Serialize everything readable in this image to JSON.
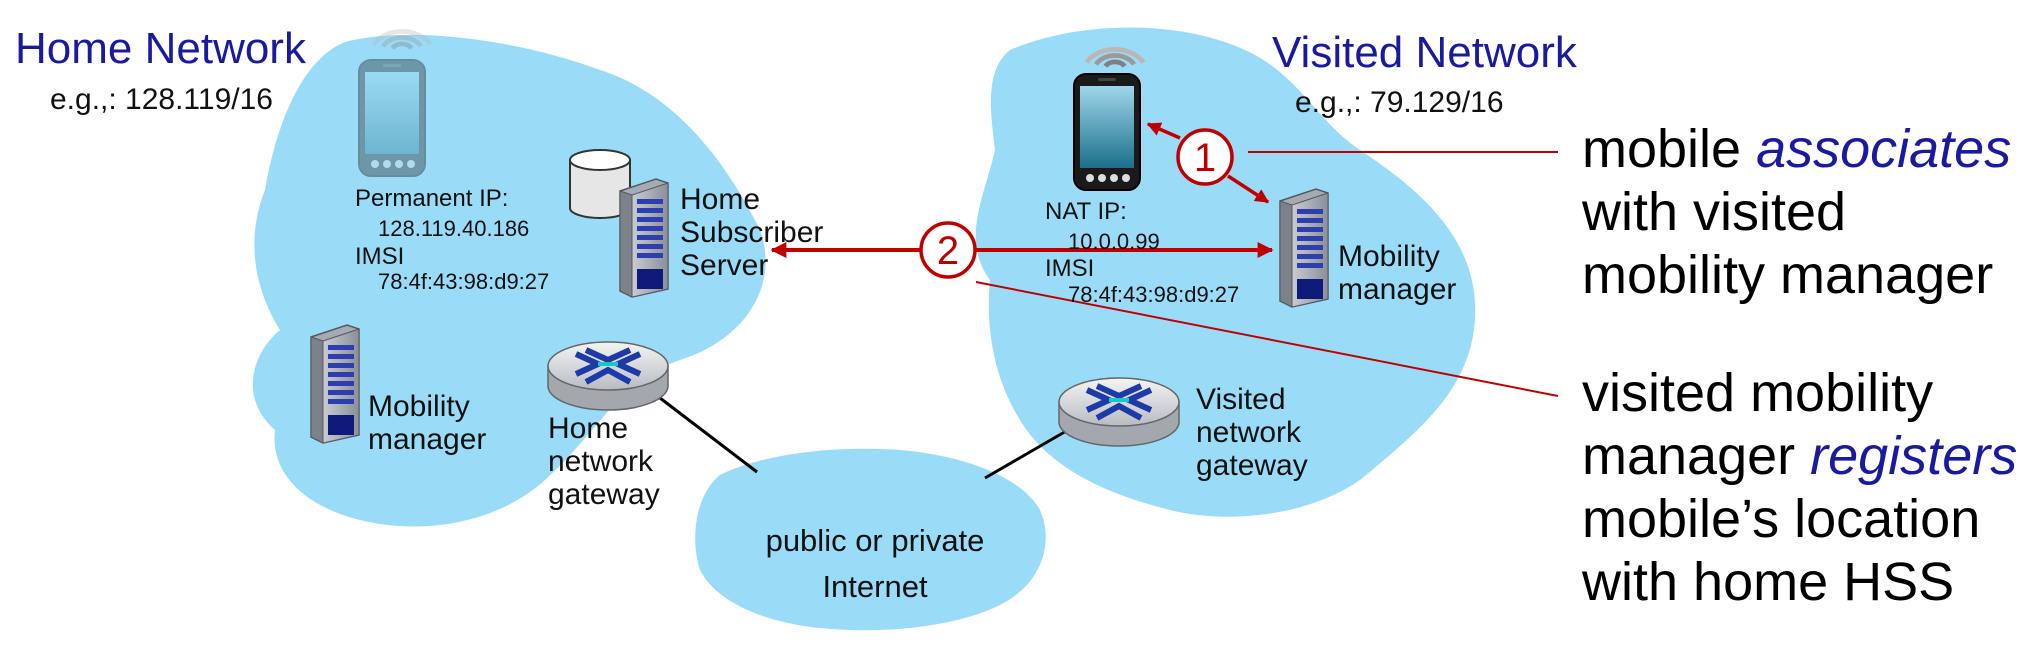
{
  "home": {
    "title": "Home Network",
    "subnet": "e.g.,: 128.119/16",
    "permanent_ip_label": "Permanent IP:",
    "permanent_ip": "128.119.40.186",
    "imsi_label": "IMSI",
    "imsi": "78:4f:43:98:d9:27",
    "hss_label": [
      "Home",
      "Subscriber",
      "Server"
    ],
    "mobility_manager_label": [
      "Mobility",
      "manager"
    ],
    "gateway_label": [
      "Home",
      "network",
      "gateway"
    ]
  },
  "visited": {
    "title": "Visited Network",
    "subnet": "e.g.,: 79.129/16",
    "nat_ip_label": "NAT IP:",
    "nat_ip": "10.0.0.99",
    "imsi_label": "IMSI",
    "imsi": "78:4f:43:98:d9:27",
    "mobility_manager_label": [
      "Mobility",
      "manager"
    ],
    "gateway_label": [
      "Visited",
      "network",
      "gateway"
    ]
  },
  "internet": {
    "label": [
      "public or  private",
      "Internet"
    ]
  },
  "steps": [
    {
      "number": "1",
      "text_before": "mobile ",
      "emphasis": "associates",
      "text_after": [
        "with visited",
        "mobility manager"
      ]
    },
    {
      "number": "2",
      "line1": "visited mobility",
      "text_before": "manager ",
      "emphasis": "registers",
      "text_after": [
        "mobile’s location",
        "with home HSS"
      ]
    }
  ],
  "colors": {
    "cloud": "#9adcf8",
    "accent": "#c00000",
    "title": "#1a1aa0"
  },
  "icons": [
    "phone-icon",
    "server-icon",
    "database-icon",
    "router-icon",
    "wireless-signal-icon"
  ]
}
